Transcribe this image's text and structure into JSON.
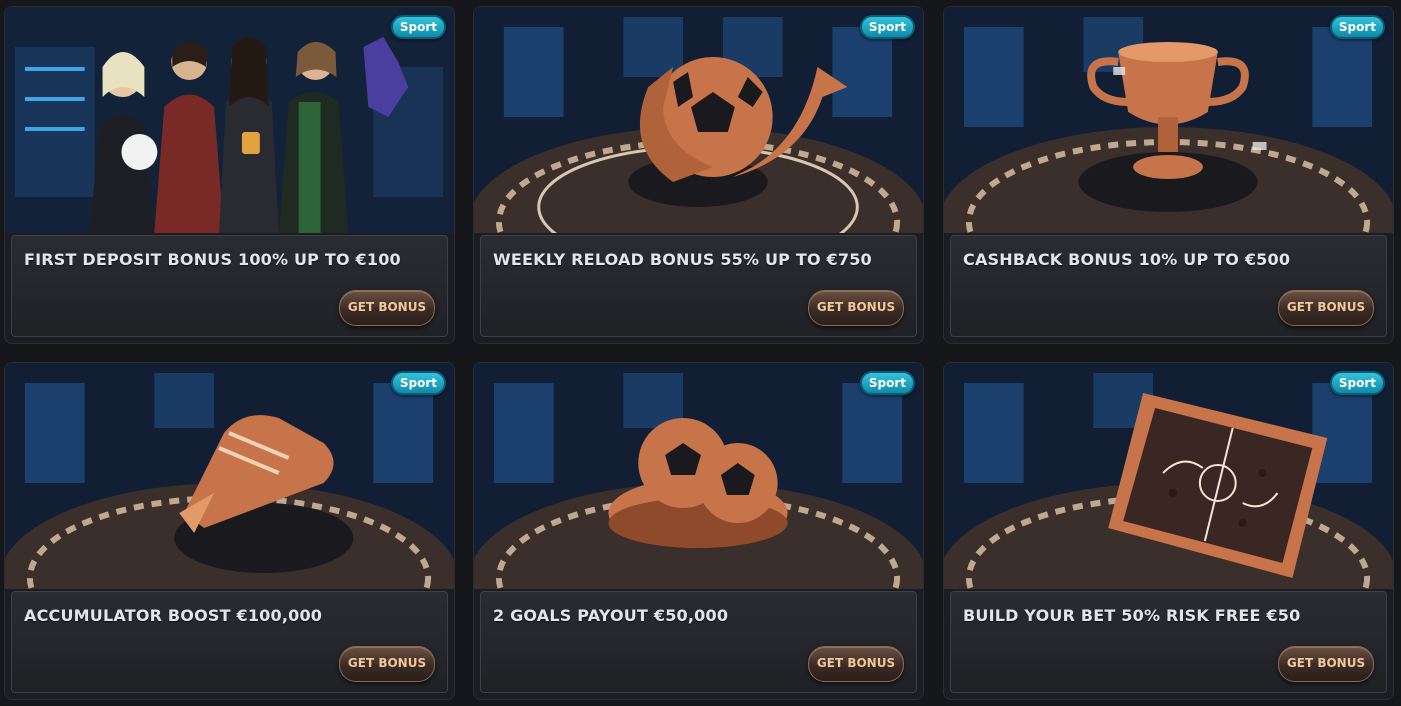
{
  "colors": {
    "page_bg": "#15171b",
    "badge": "#1aa3c2",
    "button_text": "#f2c79a",
    "copper": "#c8744a"
  },
  "cards": [
    {
      "badge": "Sport",
      "title": "FIRST DEPOSIT BONUS 100% UP TO €100",
      "button": "GET BONUS",
      "art": "group-of-fans-with-football"
    },
    {
      "badge": "Sport",
      "title": "WEEKLY RELOAD BONUS 55% UP TO €750",
      "button": "GET BONUS",
      "art": "copper-football-with-arrow"
    },
    {
      "badge": "Sport",
      "title": "CASHBACK BONUS 10% UP TO €500",
      "button": "GET BONUS",
      "art": "copper-trophy-cup"
    },
    {
      "badge": "Sport",
      "title": "ACCUMULATOR BOOST €100,000",
      "button": "GET BONUS",
      "art": "copper-football-boot"
    },
    {
      "badge": "Sport",
      "title": "2 GOALS PAYOUT €50,000",
      "button": "GET BONUS",
      "art": "two-copper-footballs"
    },
    {
      "badge": "Sport",
      "title": "BUILD YOUR BET 50% RISK FREE €50",
      "button": "GET BONUS",
      "art": "tactics-board"
    }
  ]
}
